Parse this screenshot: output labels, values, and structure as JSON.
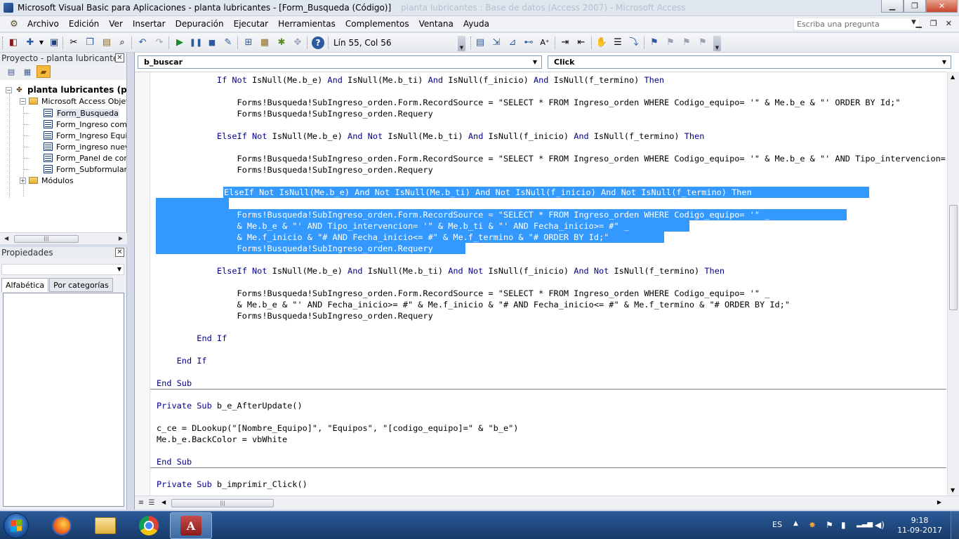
{
  "window": {
    "title": "Microsoft Visual Basic para Aplicaciones - planta lubricantes - [Form_Busqueda (Código)]",
    "background_title": "planta lubricantes : Base de datos (Access 2007) - Microsoft Access",
    "controls": [
      "minimize",
      "maximize",
      "close"
    ]
  },
  "menu": {
    "items": [
      "Archivo",
      "Edición",
      "Ver",
      "Insertar",
      "Depuración",
      "Ejecutar",
      "Herramientas",
      "Complementos",
      "Ventana",
      "Ayuda"
    ],
    "help_placeholder": "Escriba una pregunta"
  },
  "toolbar": {
    "cursor_position": "Lín 55, Col 56"
  },
  "project_pane": {
    "title": "Proyecto - planta lubricantes",
    "project_name": "planta lubricantes (plan",
    "folder_access_objects": "Microsoft Access Objeto",
    "forms": [
      "Form_Busqueda",
      "Form_Ingreso comp",
      "Form_Ingreso Equip",
      "Form_ingreso nuevo",
      "Form_Panel de cont",
      "Form_Subformulario"
    ],
    "folder_modules": "Módulos"
  },
  "properties_pane": {
    "title": "Propiedades",
    "tabs": [
      "Alfabética",
      "Por categorías"
    ]
  },
  "code_window": {
    "object_combo": "b_buscar",
    "procedure_combo": "Click"
  },
  "taskbar": {
    "language": "ES",
    "time": "9:18",
    "date": "11-09-2017"
  },
  "colors": {
    "selection": "#3399ff",
    "keyword": "#00008b",
    "taskbar": "#214b83"
  }
}
